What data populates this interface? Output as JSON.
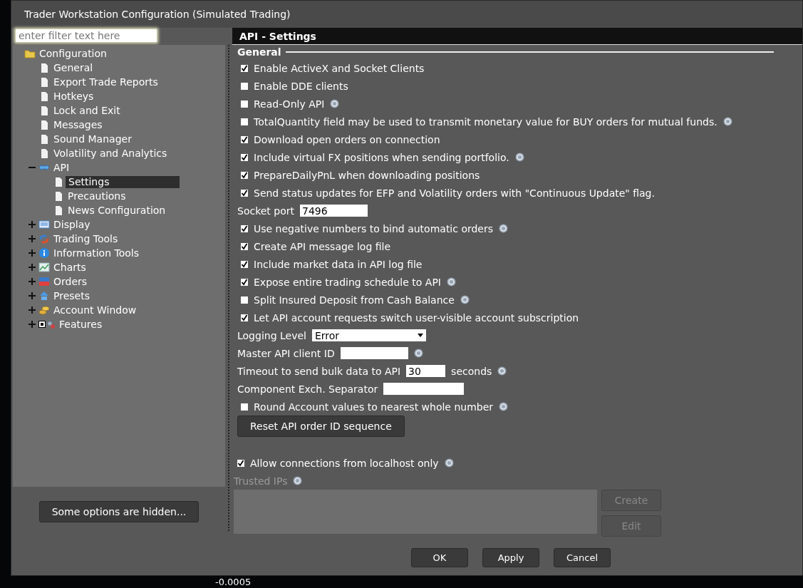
{
  "window": {
    "title": "Trader Workstation Configuration (Simulated Trading)"
  },
  "filter": {
    "placeholder": "enter filter text here"
  },
  "tree": [
    {
      "label": "Configuration",
      "selected": false,
      "children": [
        {
          "label": "General",
          "selected": false
        },
        {
          "label": "Export Trade Reports",
          "selected": false
        },
        {
          "label": "Hotkeys",
          "selected": false
        },
        {
          "label": "Lock and Exit",
          "selected": false
        },
        {
          "label": "Messages",
          "selected": false
        },
        {
          "label": "Sound Manager",
          "selected": false
        },
        {
          "label": "Volatility and Analytics",
          "selected": false
        },
        {
          "label": "API",
          "selected": false,
          "expanded": true,
          "children": [
            {
              "label": "Settings",
              "selected": true
            },
            {
              "label": "Precautions",
              "selected": false
            },
            {
              "label": "News Configuration",
              "selected": false
            }
          ]
        },
        {
          "label": "Display",
          "selected": false,
          "expanded": false
        },
        {
          "label": "Trading Tools",
          "selected": false,
          "expanded": false
        },
        {
          "label": "Information Tools",
          "selected": false,
          "expanded": false
        },
        {
          "label": "Charts",
          "selected": false,
          "expanded": false
        },
        {
          "label": "Orders",
          "selected": false,
          "expanded": false
        },
        {
          "label": "Presets",
          "selected": false,
          "expanded": false
        },
        {
          "label": "Account Window",
          "selected": false,
          "expanded": false
        },
        {
          "label": "Features",
          "selected": false,
          "expanded": false
        }
      ]
    }
  ],
  "hidden_button": "Some options are hidden...",
  "panel": {
    "title": "API - Settings",
    "section": "General",
    "rows": [
      {
        "kind": "checkbox",
        "label": "Enable ActiveX and Socket Clients",
        "checked": true,
        "help": false
      },
      {
        "kind": "checkbox",
        "label": "Enable DDE clients",
        "checked": false,
        "help": false
      },
      {
        "kind": "checkbox",
        "label": "Read-Only API",
        "checked": false,
        "help": true
      },
      {
        "kind": "checkbox",
        "label": "TotalQuantity field may be used to transmit monetary value for BUY orders for mutual funds.",
        "checked": false,
        "help": true
      },
      {
        "kind": "checkbox",
        "label": "Download open orders on connection",
        "checked": true,
        "help": false
      },
      {
        "kind": "checkbox",
        "label": "Include virtual FX positions when sending portfolio.",
        "checked": true,
        "help": true
      },
      {
        "kind": "checkbox",
        "label": "PrepareDailyPnL when downloading positions",
        "checked": true,
        "help": false
      },
      {
        "kind": "checkbox",
        "label": "Send status updates for EFP and Volatility orders with \"Continuous Update\" flag.",
        "checked": true,
        "help": false
      },
      {
        "kind": "field",
        "label": "Socket port",
        "value": "7496",
        "help": false
      },
      {
        "kind": "checkbox",
        "label": "Use negative numbers to bind automatic orders",
        "checked": true,
        "help": true
      },
      {
        "kind": "checkbox",
        "label": "Create API message log file",
        "checked": true,
        "help": false
      },
      {
        "kind": "checkbox",
        "label": "Include market data in API log file",
        "checked": true,
        "help": false
      },
      {
        "kind": "checkbox",
        "label": "Expose entire trading schedule to API",
        "checked": true,
        "help": true
      },
      {
        "kind": "checkbox",
        "label": "Split Insured Deposit from Cash Balance",
        "checked": false,
        "help": true
      },
      {
        "kind": "checkbox",
        "label": "Let API account requests switch user-visible account subscription",
        "checked": true,
        "help": false
      },
      {
        "kind": "select",
        "label": "Logging Level",
        "value": "Error",
        "help": false
      },
      {
        "kind": "field",
        "label": "Master API client ID",
        "help": true
      },
      {
        "kind": "field",
        "label": "Timeout to send bulk data to API",
        "value": "30",
        "suffix": "seconds",
        "help": true
      },
      {
        "kind": "field",
        "label": "Component Exch. Separator",
        "help": false
      },
      {
        "kind": "checkbox",
        "label": "Round Account values to nearest whole number",
        "checked": false,
        "help": true
      },
      {
        "kind": "button",
        "label": "Reset API order ID sequence"
      }
    ],
    "localhost": {
      "label": "Allow connections from localhost only",
      "checked": true,
      "help": true
    },
    "trusted": {
      "label": "Trusted IPs",
      "disabled": true,
      "help": true,
      "buttons": [
        {
          "label": "Create",
          "disabled": true
        },
        {
          "label": "Edit",
          "disabled": true
        }
      ]
    }
  },
  "footer_buttons": [
    "OK",
    "Apply",
    "Cancel"
  ],
  "background_text": "-0.0005"
}
